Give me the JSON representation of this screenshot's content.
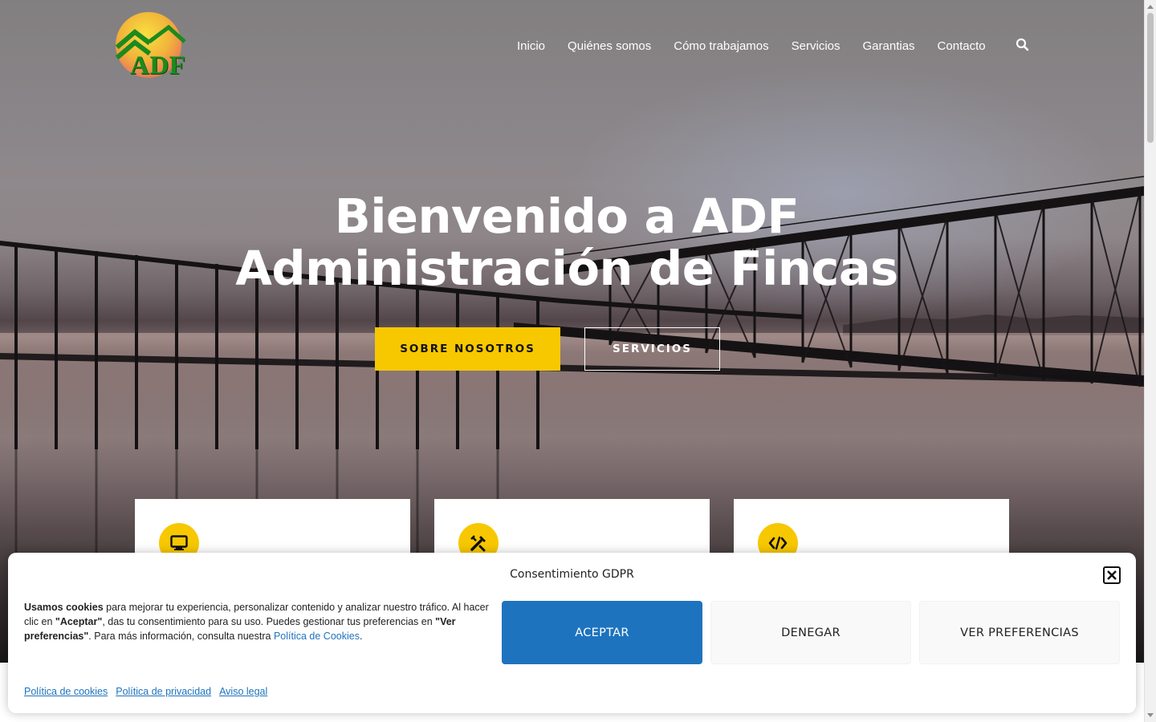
{
  "brand": {
    "logo_text": "ADF"
  },
  "nav": {
    "items": [
      {
        "label": "Inicio"
      },
      {
        "label": "Quiénes somos"
      },
      {
        "label": "Cómo trabajamos"
      },
      {
        "label": "Servicios"
      },
      {
        "label": "Garantias"
      },
      {
        "label": "Contacto"
      }
    ],
    "search_icon": "search-icon"
  },
  "hero": {
    "title_line1": "Bienvenido a ADF",
    "title_line2": "Administración de Fincas",
    "primary_button": "SOBRE NOSOTROS",
    "secondary_button": "SERVICIOS"
  },
  "cards": [
    {
      "icon": "monitor-icon"
    },
    {
      "icon": "tools-icon"
    },
    {
      "icon": "code-icon"
    }
  ],
  "cookie_banner": {
    "title": "Consentimiento GDPR",
    "text_bold_1": "Usamos cookies",
    "text_1": " para mejorar tu experiencia, personalizar contenido y analizar nuestro tráfico. Al hacer clic en ",
    "text_bold_2": "\"Aceptar\"",
    "text_2": ", das tu consentimiento para su uso. Puedes gestionar tus preferencias en ",
    "text_bold_3": "\"Ver preferencias\"",
    "text_3": ". Para más información, consulta nuestra ",
    "policy_link": "Política de Cookies",
    "text_end": ".",
    "accept_label": "ACEPTAR",
    "deny_label": "DENEGAR",
    "preferences_label": "VER PREFERENCIAS",
    "links": [
      {
        "label": "Política de cookies"
      },
      {
        "label": "Política de privacidad"
      },
      {
        "label": "Aviso legal"
      }
    ]
  },
  "colors": {
    "accent_yellow": "#f7c800",
    "accept_blue": "#1e73be",
    "logo_green": "#1c8a1e"
  }
}
